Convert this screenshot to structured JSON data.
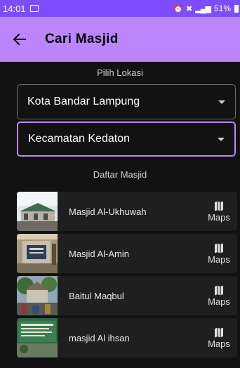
{
  "status_bar": {
    "time": "14:01",
    "battery": "51%"
  },
  "app_bar": {
    "title": "Cari Masjid",
    "back_icon": "arrow-back-icon"
  },
  "location": {
    "label": "Pilih Lokasi",
    "city": "Kota Bandar Lampung",
    "district": "Kecamatan Kedaton"
  },
  "list": {
    "label": "Daftar Masjid",
    "items": [
      {
        "name": "Masjid Al-Ukhuwah",
        "maps_label": "Maps"
      },
      {
        "name": "Masjid Al-Amin",
        "maps_label": "Maps"
      },
      {
        "name": "Baitul Maqbul",
        "maps_label": "Maps"
      },
      {
        "name": "masjid Al ihsan",
        "maps_label": "Maps"
      }
    ]
  },
  "colors": {
    "status_bar": "#7c4dff",
    "app_bar": "#bb86fc",
    "background": "#121212",
    "card": "#1f1f1f",
    "focus_border": "#bb86fc"
  }
}
